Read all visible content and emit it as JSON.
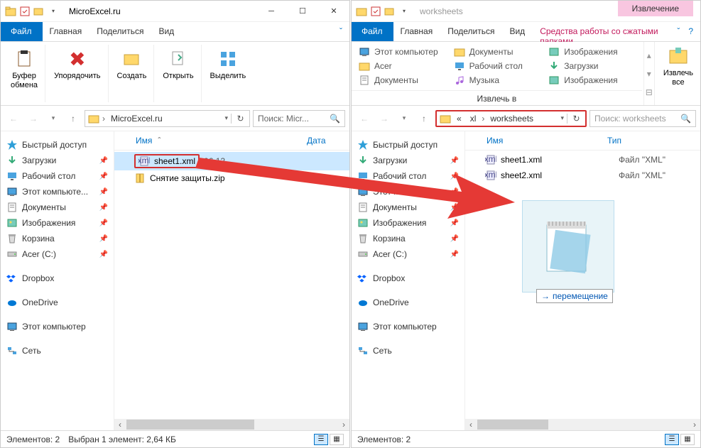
{
  "left": {
    "title": "MicroExcel.ru",
    "tabs": {
      "file": "Файл",
      "home": "Главная",
      "share": "Поделиться",
      "view": "Вид"
    },
    "ribbon": {
      "clipboard": "Буфер\nобмена",
      "organize": "Упорядочить",
      "create": "Создать",
      "open": "Открыть",
      "select": "Выделить"
    },
    "address": {
      "crumb": "MicroExcel.ru"
    },
    "search_placeholder": "Поиск: Micr...",
    "columns": {
      "name": "Имя",
      "date": "Дата"
    },
    "files": [
      {
        "icon": "xml",
        "name": "sheet1.xml",
        "date": "06.12.",
        "selected": true,
        "highlight": true
      },
      {
        "icon": "zip",
        "name": "Снятие защиты.zip",
        "date": "06.12."
      }
    ],
    "status": {
      "count": "Элементов: 2",
      "selected": "Выбран 1 элемент: 2,64 КБ"
    }
  },
  "right": {
    "title": "worksheets",
    "context_tab": "Извлечение",
    "tabs": {
      "file": "Файл",
      "home": "Главная",
      "share": "Поделиться",
      "view": "Вид",
      "tools": "Средства работы со сжатыми папками"
    },
    "extract_targets": [
      {
        "icon": "pc",
        "label": "Этот компьютер"
      },
      {
        "icon": "folder",
        "label": "Документы"
      },
      {
        "icon": "pictures",
        "label": "Изображения"
      },
      {
        "icon": "folder",
        "label": "Acer"
      },
      {
        "icon": "desktop",
        "label": "Рабочий стол"
      },
      {
        "icon": "downloads",
        "label": "Загрузки"
      },
      {
        "icon": "docs",
        "label": "Документы"
      },
      {
        "icon": "music",
        "label": "Музыка"
      },
      {
        "icon": "pictures",
        "label": "Изображения"
      }
    ],
    "extract_title": "Извлечь в",
    "extract_all": "Извлечь\nвсе",
    "address": {
      "pre": "«",
      "crumb1": "xl",
      "crumb2": "worksheets"
    },
    "search_placeholder": "Поиск: worksheets",
    "columns": {
      "name": "Имя",
      "type": "Тип"
    },
    "files": [
      {
        "icon": "xml",
        "name": "sheet1.xml",
        "type": "Файл \"XML\""
      },
      {
        "icon": "xml",
        "name": "sheet2.xml",
        "type": "Файл \"XML\""
      }
    ],
    "drop_label": "перемещение",
    "status": {
      "count": "Элементов: 2"
    }
  },
  "sidebar": [
    {
      "icon": "star",
      "label": "Быстрый доступ",
      "header": true,
      "color": "#2e9fd8"
    },
    {
      "icon": "down",
      "label": "Загрузки",
      "pin": true
    },
    {
      "icon": "desktop",
      "label": "Рабочий стол",
      "pin": true
    },
    {
      "icon": "pc",
      "label": "Этот компьютер",
      "pin": true,
      "trunc": "Этот компьюте..."
    },
    {
      "icon": "docs",
      "label": "Документы",
      "pin": true
    },
    {
      "icon": "pics",
      "label": "Изображения",
      "pin": true
    },
    {
      "icon": "trash",
      "label": "Корзина",
      "pin": true
    },
    {
      "icon": "disk",
      "label": "Acer (C:)",
      "pin": true
    },
    {
      "gap": true
    },
    {
      "icon": "dropbox",
      "label": "Dropbox"
    },
    {
      "gap": true
    },
    {
      "icon": "onedrive",
      "label": "OneDrive"
    },
    {
      "gap": true
    },
    {
      "icon": "pc",
      "label": "Этот компьютер"
    },
    {
      "gap": true
    },
    {
      "icon": "net",
      "label": "Сеть"
    }
  ]
}
